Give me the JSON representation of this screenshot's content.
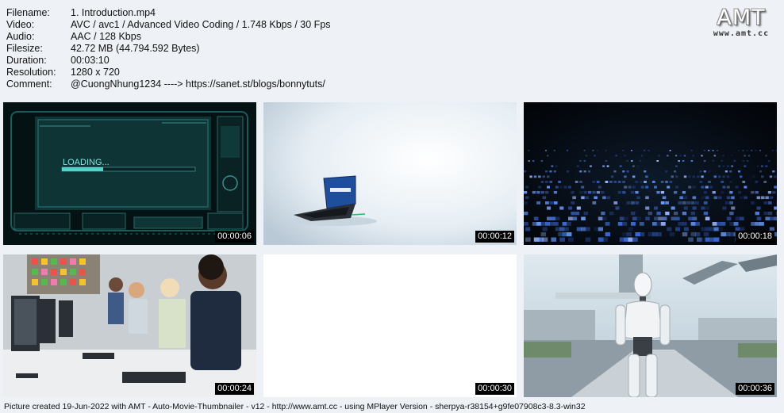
{
  "info": {
    "rows": [
      {
        "key": "Filename:",
        "value": "1. Introduction.mp4"
      },
      {
        "key": "Video:",
        "value": "AVC / avc1 / Advanced Video Coding / 1.748 Kbps / 30 Fps"
      },
      {
        "key": "Audio:",
        "value": "AAC / 128 Kbps"
      },
      {
        "key": "Filesize:",
        "value": "42.72 MB (44.794.592 Bytes)"
      },
      {
        "key": "Duration:",
        "value": "00:03:10"
      },
      {
        "key": "Resolution:",
        "value": "1280 x 720"
      },
      {
        "key": "Comment:",
        "value": "@CuongNhung1234 ----> https://sanet.st/blogs/bonnytuts/"
      }
    ]
  },
  "logo": {
    "text": "AMT",
    "url": "www.amt.cc"
  },
  "thumbnails": [
    {
      "timestamp": "00:00:06",
      "caption": "LOADING..."
    },
    {
      "timestamp": "00:00:12",
      "caption": "UPLOADING"
    },
    {
      "timestamp": "00:00:18"
    },
    {
      "timestamp": "00:00:24"
    },
    {
      "timestamp": "00:00:30"
    },
    {
      "timestamp": "00:00:36"
    }
  ],
  "footer": "Picture created 19-Jun-2022 with AMT - Auto-Movie-Thumbnailer - v12 - http://www.amt.cc - using MPlayer Version - sherpya-r38154+g9fe07908c3-8.3-win32"
}
